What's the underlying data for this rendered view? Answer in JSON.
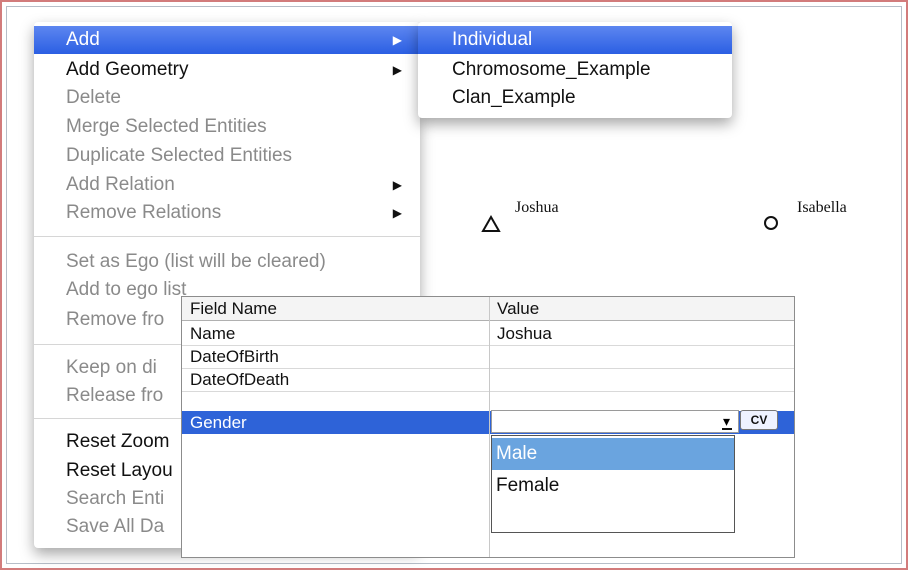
{
  "context_menu": {
    "items": [
      {
        "label": "Add",
        "state": "highlighted",
        "submenu": true
      },
      {
        "label": "Add Geometry",
        "state": "enabled",
        "submenu": true
      },
      {
        "label": "Delete",
        "state": "disabled"
      },
      {
        "label": "Merge Selected Entities",
        "state": "disabled"
      },
      {
        "label": "Duplicate Selected Entities",
        "state": "disabled"
      },
      {
        "label": "Add Relation",
        "state": "disabled",
        "submenu": true
      },
      {
        "label": "Remove Relations",
        "state": "disabled",
        "submenu": true
      },
      {
        "label": "Set as Ego (list will be cleared)",
        "state": "disabled"
      },
      {
        "label": "Add to ego list",
        "state": "disabled"
      },
      {
        "label": "Remove fro",
        "state": "disabled"
      },
      {
        "label": "Keep on di",
        "state": "disabled"
      },
      {
        "label": "Release fro",
        "state": "disabled"
      },
      {
        "label": "Reset Zoom",
        "state": "enabled"
      },
      {
        "label": "Reset Layou",
        "state": "enabled"
      },
      {
        "label": "Search Enti",
        "state": "disabled"
      },
      {
        "label": "Save All Da",
        "state": "disabled"
      }
    ],
    "arrow_glyph": "▶"
  },
  "add_submenu": {
    "items": [
      {
        "label": "Individual",
        "state": "highlighted"
      },
      {
        "label": "Chromosome_Example",
        "state": "enabled"
      },
      {
        "label": "Clan_Example",
        "state": "enabled"
      }
    ]
  },
  "diagram": {
    "nodes": [
      {
        "label": "Joshua",
        "shape": "triangle"
      },
      {
        "label": "Isabella",
        "shape": "circle"
      }
    ]
  },
  "property_table": {
    "headers": {
      "field": "Field Name",
      "value": "Value"
    },
    "rows": [
      {
        "field": "Name",
        "value": "Joshua"
      },
      {
        "field": "DateOfBirth",
        "value": ""
      },
      {
        "field": "DateOfDeath",
        "value": ""
      },
      {
        "field": "Gender",
        "value": "",
        "selected": true
      }
    ],
    "cv_button": "CV",
    "gender_options": [
      {
        "label": "Male",
        "state": "highlighted"
      },
      {
        "label": "Female",
        "state": "enabled"
      }
    ]
  },
  "colors": {
    "menu_highlight": "#2b5fe3",
    "row_selection": "#2e63d8",
    "dropdown_highlight": "#6aa4df",
    "frame_border": "#d27c7c"
  }
}
